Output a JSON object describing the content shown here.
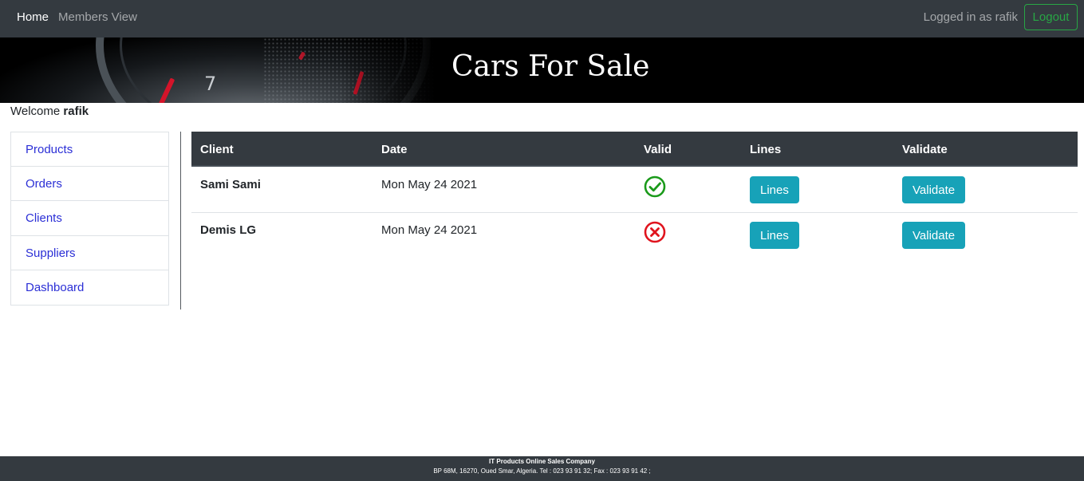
{
  "navbar": {
    "links": [
      "Home",
      "Members View"
    ],
    "user_text": "Logged in as rafik",
    "logout_label": "Logout"
  },
  "banner": {
    "title": "Cars For Sale",
    "gauge_number": "7"
  },
  "welcome": {
    "prefix": "Welcome ",
    "username": "rafik"
  },
  "sidebar": {
    "items": [
      "Products",
      "Orders",
      "Clients",
      "Suppliers",
      "Dashboard"
    ]
  },
  "table": {
    "headers": [
      "Client",
      "Date",
      "Valid",
      "Lines",
      "Validate"
    ],
    "rows": [
      {
        "client": "Sami Sami",
        "date": "Mon May 24 2021",
        "valid": true,
        "lines_label": "Lines",
        "validate_label": "Validate"
      },
      {
        "client": "Demis LG",
        "date": "Mon May 24 2021",
        "valid": false,
        "lines_label": "Lines",
        "validate_label": "Validate"
      }
    ]
  },
  "colors": {
    "navbar": "#343a40",
    "valid_ok": "#1a9a1a",
    "valid_bad": "#e0141e",
    "button_info": "#17a2b8",
    "link": "#2b2fd6",
    "logout": "#28a745"
  },
  "footer": {
    "company": "IT Products Online Sales Company",
    "address": "BP 68M, 16270, Oued Smar, Algeria. Tel : 023 93 91 32; Fax : 023 93 91 42 ;"
  }
}
